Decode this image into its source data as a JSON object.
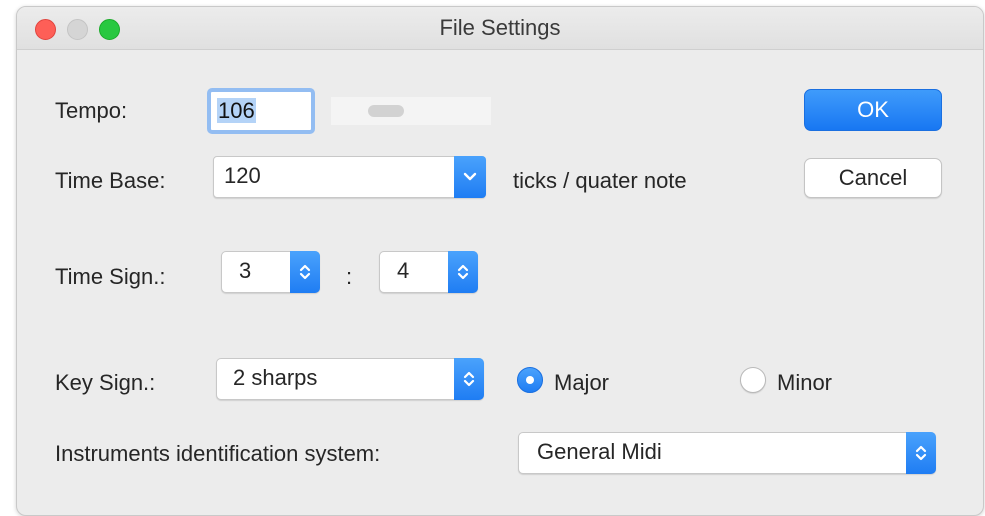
{
  "window": {
    "title": "File Settings"
  },
  "tempo": {
    "label": "Tempo:",
    "value": "106",
    "slider_level": 0.3
  },
  "time_base": {
    "label": "Time Base:",
    "value": "120",
    "unit": "ticks / quater note"
  },
  "time_sign": {
    "label": "Time Sign.:",
    "numerator": "3",
    "separator": ":",
    "denominator": "4"
  },
  "key_sign": {
    "label": "Key Sign.:",
    "value": "2 sharps",
    "mode_major": "Major",
    "mode_minor": "Minor",
    "selected_mode": "Major"
  },
  "instruments": {
    "label": "Instruments identification system:",
    "value": "General Midi"
  },
  "buttons": {
    "ok": "OK",
    "cancel": "Cancel"
  },
  "colors": {
    "accent": "#1f7df3",
    "focus_ring": "#93bdf2"
  }
}
